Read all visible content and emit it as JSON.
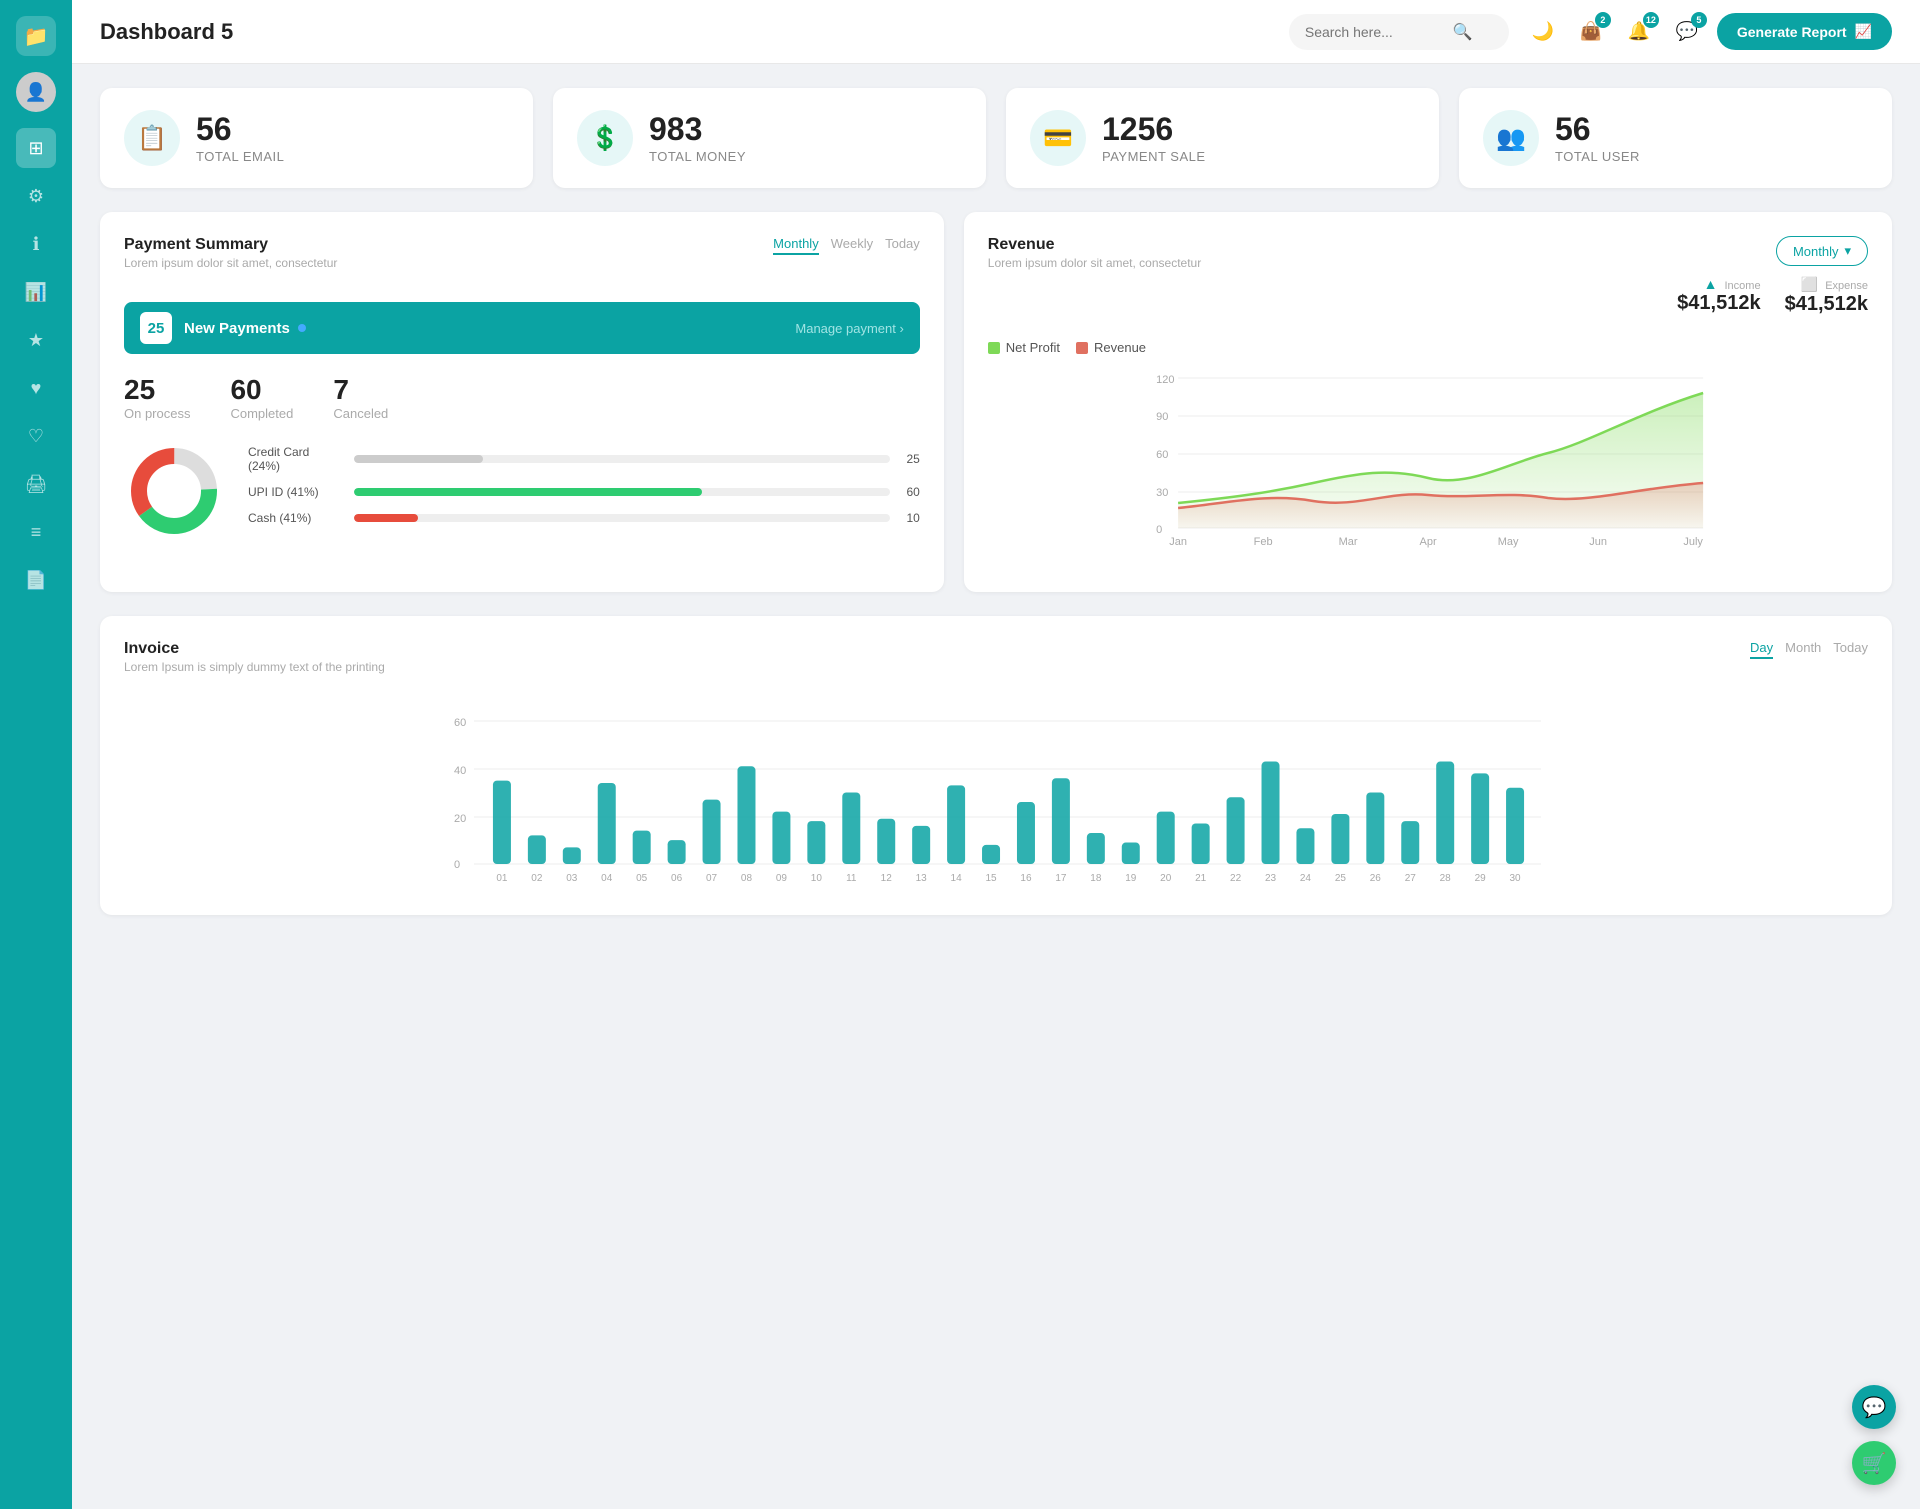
{
  "app": {
    "title": "Dashboard 5",
    "generate_report": "Generate Report"
  },
  "search": {
    "placeholder": "Search here..."
  },
  "header_icons": {
    "moon_badge": "",
    "wallet_badge": "2",
    "bell_badge": "12",
    "chat_badge": "5"
  },
  "stat_cards": [
    {
      "icon": "📋",
      "value": "56",
      "label": "TOTAL EMAIL"
    },
    {
      "icon": "💲",
      "value": "983",
      "label": "TOTAL MONEY"
    },
    {
      "icon": "💳",
      "value": "1256",
      "label": "PAYMENT SALE"
    },
    {
      "icon": "👥",
      "value": "56",
      "label": "TOTAL USER"
    }
  ],
  "payment_summary": {
    "title": "Payment Summary",
    "subtitle": "Lorem ipsum dolor sit amet, consectetur",
    "tabs": [
      "Monthly",
      "Weekly",
      "Today"
    ],
    "active_tab": "Monthly",
    "new_payments_count": "25",
    "new_payments_label": "New Payments",
    "manage_link": "Manage payment",
    "stats": [
      {
        "value": "25",
        "label": "On process"
      },
      {
        "value": "60",
        "label": "Completed"
      },
      {
        "value": "7",
        "label": "Canceled"
      }
    ],
    "donut": {
      "segments": [
        {
          "label": "Credit Card (24%)",
          "color": "#ccc",
          "pct": 24,
          "value": "25"
        },
        {
          "label": "UPI ID (41%)",
          "color": "#2ecc71",
          "pct": 41,
          "value": "60"
        },
        {
          "label": "Cash (41%)",
          "color": "#e74c3c",
          "pct": 41,
          "value": "10"
        }
      ]
    }
  },
  "revenue": {
    "title": "Revenue",
    "subtitle": "Lorem ipsum dolor sit amet, consectetur",
    "monthly_label": "Monthly",
    "income_label": "Income",
    "income_value": "$41,512k",
    "expense_label": "Expense",
    "expense_value": "$41,512k",
    "legend": [
      {
        "label": "Net Profit",
        "color": "#7ed957"
      },
      {
        "label": "Revenue",
        "color": "#e07060"
      }
    ],
    "x_labels": [
      "Jan",
      "Feb",
      "Mar",
      "Apr",
      "May",
      "Jun",
      "July"
    ],
    "y_labels": [
      "0",
      "30",
      "60",
      "90",
      "120"
    ]
  },
  "invoice": {
    "title": "Invoice",
    "subtitle": "Lorem Ipsum is simply dummy text of the printing",
    "tabs": [
      "Day",
      "Month",
      "Today"
    ],
    "active_tab": "Day",
    "y_labels": [
      "0",
      "20",
      "40",
      "60"
    ],
    "x_labels": [
      "01",
      "02",
      "03",
      "04",
      "05",
      "06",
      "07",
      "08",
      "09",
      "10",
      "11",
      "12",
      "13",
      "14",
      "15",
      "16",
      "17",
      "18",
      "19",
      "20",
      "21",
      "22",
      "23",
      "24",
      "25",
      "26",
      "27",
      "28",
      "29",
      "30"
    ],
    "bar_data": [
      35,
      12,
      7,
      34,
      14,
      10,
      27,
      41,
      22,
      18,
      30,
      19,
      16,
      33,
      8,
      26,
      36,
      13,
      9,
      22,
      17,
      28,
      43,
      15,
      21,
      30,
      18,
      43,
      38,
      32
    ]
  },
  "fab": {
    "support_icon": "💬",
    "cart_icon": "🛒"
  }
}
